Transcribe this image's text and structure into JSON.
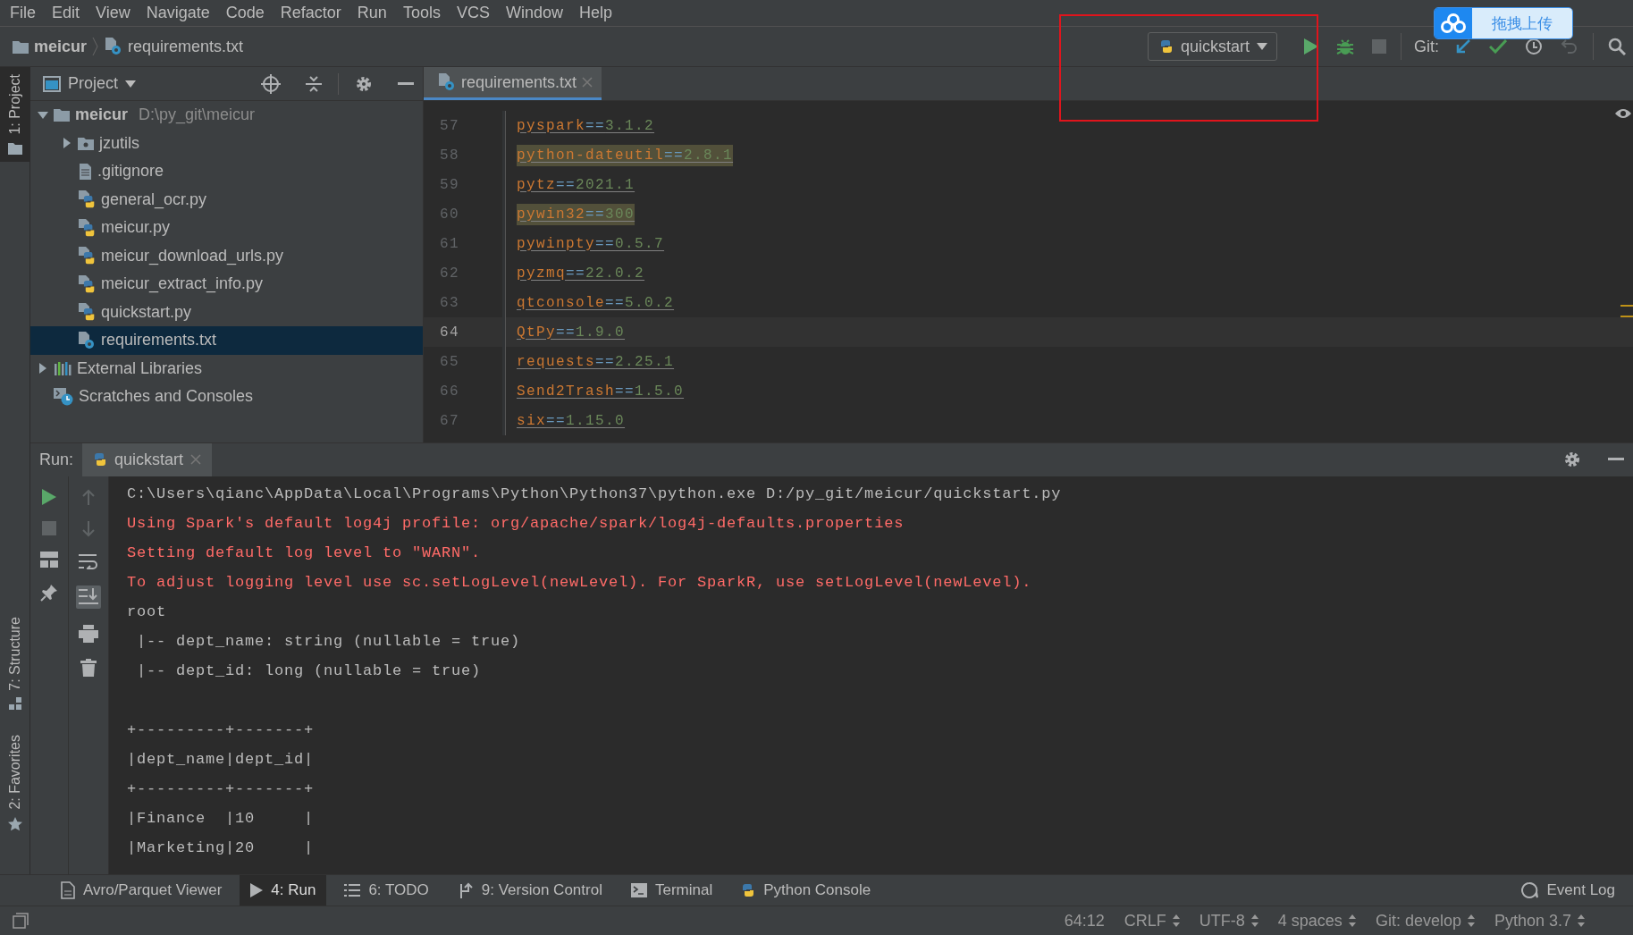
{
  "menu": [
    "File",
    "Edit",
    "View",
    "Navigate",
    "Code",
    "Refactor",
    "Run",
    "Tools",
    "VCS",
    "Window",
    "Help"
  ],
  "navigation": {
    "project": "meicur",
    "file": "requirements.txt"
  },
  "toolbar": {
    "run_config": "quickstart",
    "git_label": "Git:"
  },
  "upload_widget": {
    "label": "拖拽上传"
  },
  "side_tabs": [
    {
      "label": "1: Project",
      "selected": true,
      "kind": "project"
    },
    {
      "label": "7: Structure",
      "selected": false,
      "kind": "structure"
    },
    {
      "label": "2: Favorites",
      "selected": false,
      "kind": "favorites"
    }
  ],
  "project_panel": {
    "title": "Project",
    "tree": [
      {
        "label": "meicur",
        "path": "D:\\py_git\\meicur",
        "kind": "root",
        "expanded": true,
        "selected": false,
        "children": [
          {
            "label": "jzutils",
            "kind": "package",
            "expanded": false,
            "selected": false
          },
          {
            "label": ".gitignore",
            "kind": "text",
            "selected": false
          },
          {
            "label": "general_ocr.py",
            "kind": "python",
            "selected": false
          },
          {
            "label": "meicur.py",
            "kind": "python",
            "selected": false
          },
          {
            "label": "meicur_download_urls.py",
            "kind": "python",
            "selected": false
          },
          {
            "label": "meicur_extract_info.py",
            "kind": "python",
            "selected": false
          },
          {
            "label": "quickstart.py",
            "kind": "python",
            "selected": false
          },
          {
            "label": "requirements.txt",
            "kind": "requirements",
            "selected": true
          }
        ]
      },
      {
        "label": "External Libraries",
        "kind": "libraries",
        "expanded": false,
        "selected": false
      },
      {
        "label": "Scratches and Consoles",
        "kind": "scratches",
        "selected": false
      }
    ]
  },
  "editor": {
    "tabs": [
      {
        "label": "requirements.txt",
        "selected": true
      }
    ],
    "lines": [
      {
        "number": "57",
        "package": "pyspark",
        "operator": "==",
        "version": "3.1.2",
        "highlighted": false,
        "current": false
      },
      {
        "number": "58",
        "package": "python-dateutil",
        "operator": "==",
        "version": "2.8.1",
        "highlighted": true,
        "current": false
      },
      {
        "number": "59",
        "package": "pytz",
        "operator": "==",
        "version": "2021.1",
        "highlighted": false,
        "current": false
      },
      {
        "number": "60",
        "package": "pywin32",
        "operator": "==",
        "version": "300",
        "highlighted": true,
        "current": false
      },
      {
        "number": "61",
        "package": "pywinpty",
        "operator": "==",
        "version": "0.5.7",
        "highlighted": false,
        "current": false
      },
      {
        "number": "62",
        "package": "pyzmq",
        "operator": "==",
        "version": "22.0.2",
        "highlighted": false,
        "current": false
      },
      {
        "number": "63",
        "package": "qtconsole",
        "operator": "==",
        "version": "5.0.2",
        "highlighted": false,
        "current": false
      },
      {
        "number": "64",
        "package": "QtPy",
        "operator": "==",
        "version": "1.9.0",
        "highlighted": false,
        "current": true
      },
      {
        "number": "65",
        "package": "requests",
        "operator": "==",
        "version": "2.25.1",
        "highlighted": false,
        "current": false
      },
      {
        "number": "66",
        "package": "Send2Trash",
        "operator": "==",
        "version": "1.5.0",
        "highlighted": false,
        "current": false
      },
      {
        "number": "67",
        "package": "six",
        "operator": "==",
        "version": "1.15.0",
        "highlighted": false,
        "current": false
      }
    ]
  },
  "run_panel": {
    "label": "Run:",
    "tabs": [
      {
        "label": "quickstart",
        "selected": true
      }
    ],
    "lines": [
      {
        "kind": "command",
        "text": "C:\\Users\\qianc\\AppData\\Local\\Programs\\Python\\Python37\\python.exe D:/py_git/meicur/quickstart.py"
      },
      {
        "kind": "error",
        "text": "Using Spark's default log4j profile: org/apache/spark/log4j-defaults.properties"
      },
      {
        "kind": "error",
        "text": "Setting default log level to \"WARN\"."
      },
      {
        "kind": "error",
        "text": "To adjust logging level use sc.setLogLevel(newLevel). For SparkR, use setLogLevel(newLevel)."
      },
      {
        "kind": "output",
        "text": "root"
      },
      {
        "kind": "output",
        "text": " |-- dept_name: string (nullable = true)"
      },
      {
        "kind": "output",
        "text": " |-- dept_id: long (nullable = true)"
      }
    ],
    "table_lines": [
      "+---------+-------+",
      "|dept_name|dept_id|",
      "+---------+-------+",
      "|Finance  |10     |",
      "|Marketing|20     |"
    ]
  },
  "tool_windows": [
    {
      "label": "Avro/Parquet Viewer",
      "kind": "viewer",
      "selected": false
    },
    {
      "label": "4: Run",
      "kind": "run",
      "selected": true
    },
    {
      "label": "6: TODO",
      "kind": "todo",
      "selected": false
    },
    {
      "label": "9: Version Control",
      "kind": "vcs",
      "selected": false
    },
    {
      "label": "Terminal",
      "kind": "terminal",
      "selected": false
    },
    {
      "label": "Python Console",
      "kind": "python",
      "selected": false
    }
  ],
  "event_log": "Event Log",
  "status_bar": [
    {
      "text": "64:12",
      "kind": "plain"
    },
    {
      "text": "CRLF",
      "kind": "select"
    },
    {
      "text": "UTF-8",
      "kind": "select"
    },
    {
      "text": "4 spaces",
      "kind": "select"
    },
    {
      "text": "Git: develop",
      "kind": "select"
    },
    {
      "text": "Python 3.7",
      "kind": "select"
    }
  ]
}
